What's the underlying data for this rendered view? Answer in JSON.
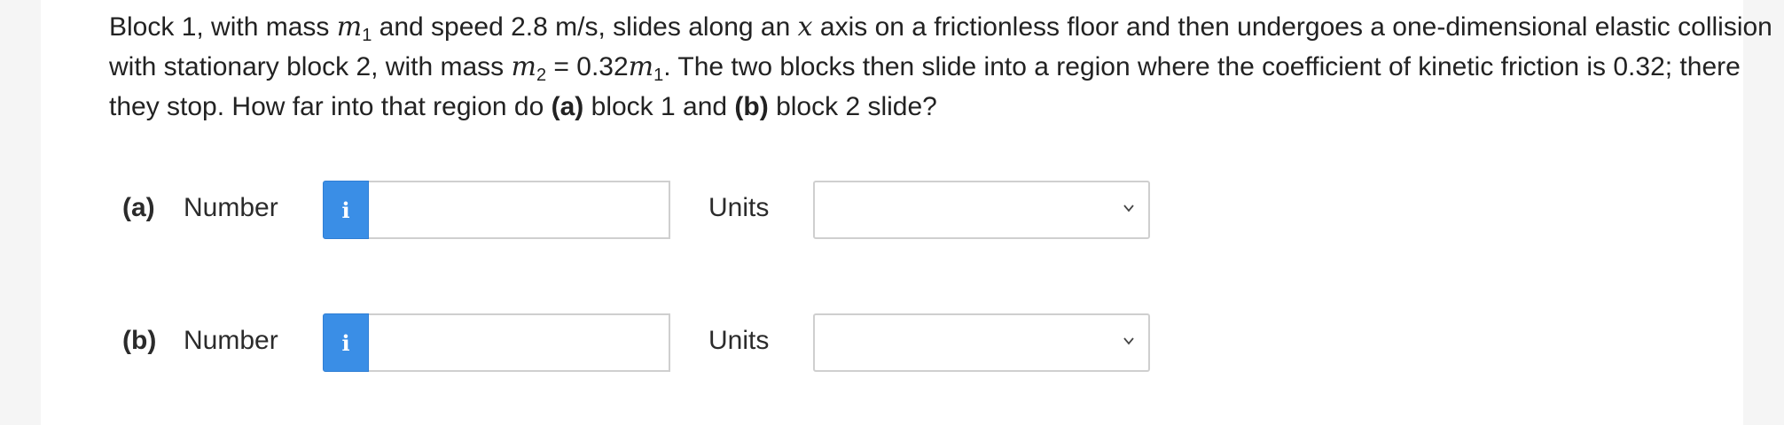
{
  "question": {
    "p1": "Block 1, with mass ",
    "m1_var": "m",
    "m1_sub": "1",
    "p2": " and speed 2.8 m/s, slides along an ",
    "x_var": "x",
    "p3": " axis on a frictionless floor and then undergoes a one-dimensional elastic collision with stationary block 2, with mass ",
    "m2_var": "m",
    "m2_sub": "2",
    "p4": " = 0.32",
    "m1b_var": "m",
    "m1b_sub": "1",
    "p5": ". The two blocks then slide into a region where the coefficient of kinetic friction is 0.32; there they stop. How far into that region do ",
    "a_marker": "(a)",
    "p6": " block 1 and ",
    "b_marker": "(b)",
    "p7": " block 2 slide?"
  },
  "parts": [
    {
      "label": "(a)",
      "number_label": "Number",
      "info_icon": "i",
      "number_value": "",
      "units_label": "Units",
      "units_value": ""
    },
    {
      "label": "(b)",
      "number_label": "Number",
      "info_icon": "i",
      "number_value": "",
      "units_label": "Units",
      "units_value": ""
    }
  ],
  "colors": {
    "info_button": "#3a8ee6",
    "background": "#f5f5f5",
    "card": "#ffffff"
  },
  "icons": {
    "info": "info-icon",
    "dropdown": "chevron-down-icon"
  }
}
